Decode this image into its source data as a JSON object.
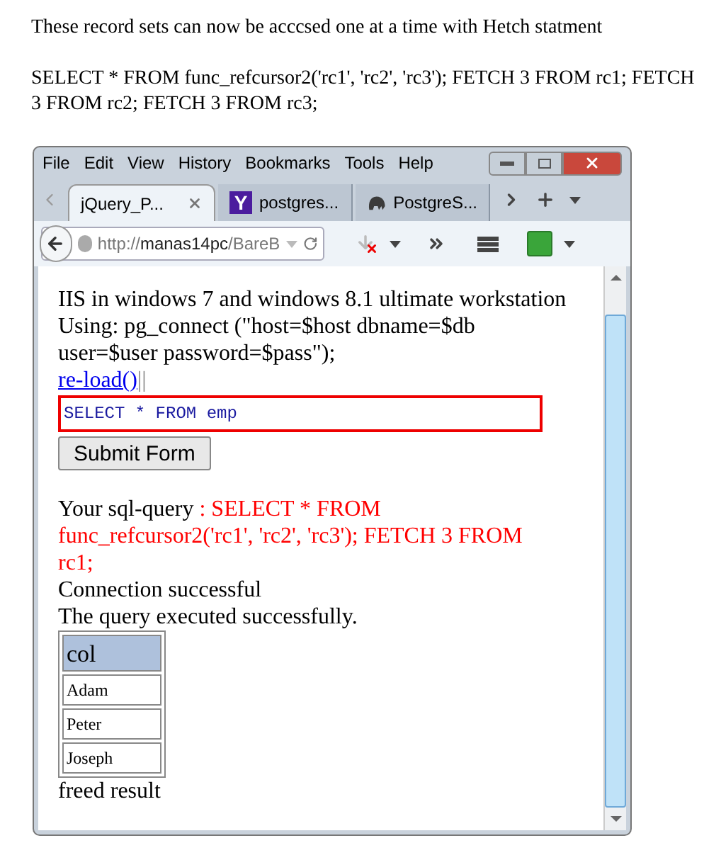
{
  "intro": "These record sets can now be acccsed one at a time with Hetch statment",
  "query_text": "SELECT * FROM func_refcursor2('rc1', 'rc2', 'rc3'); FETCH 3 FROM rc1; FETCH 3 FROM rc2; FETCH 3 FROM rc3;",
  "browser": {
    "menu": [
      "File",
      "Edit",
      "View",
      "History",
      "Bookmarks",
      "Tools",
      "Help"
    ],
    "tabs": [
      {
        "label": "jQuery_P...",
        "selected": true,
        "kind": "plain"
      },
      {
        "label": "postgres...",
        "selected": false,
        "kind": "yahoo"
      },
      {
        "label": "PostgreS...",
        "selected": false,
        "kind": "elephant"
      }
    ],
    "yahoo_letter": "Y",
    "url": {
      "scheme": "http://",
      "host": "manas14pc",
      "path": "/BareB"
    },
    "content": {
      "lines": [
        "IIS in windows 7 and windows 8.1 ultimate workstation",
        "Using: pg_connect (\"host=$host dbname=$db user=$user password=$pass\");"
      ],
      "link": "re-load()",
      "link_suffix": "||",
      "query_field": "SELECT * FROM emp",
      "submit": "Submit Form",
      "sql_label": "Your sql-query ",
      "sql_value": ": SELECT * FROM func_refcursor2('rc1', 'rc2', 'rc3'); FETCH 3 FROM rc1;",
      "status": [
        "Connection successful",
        "The query executed successfully."
      ],
      "table": {
        "columns": [
          "col"
        ],
        "rows": [
          [
            "Adam"
          ],
          [
            "Peter"
          ],
          [
            "Joseph"
          ]
        ]
      },
      "footer": "freed result"
    }
  }
}
